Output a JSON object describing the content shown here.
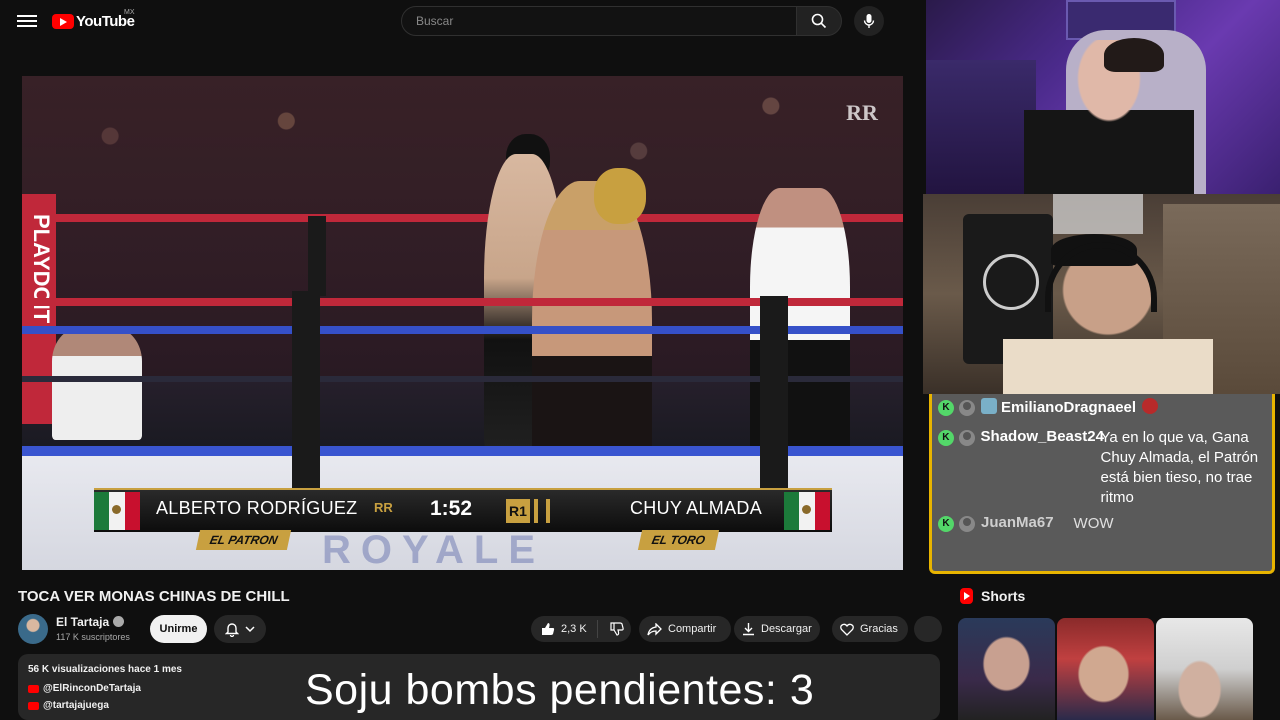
{
  "header": {
    "logo_text": "YouTube",
    "country": "MX",
    "search_placeholder": "Buscar"
  },
  "video": {
    "scoreboard": {
      "left_name": "ALBERTO RODRÍGUEZ",
      "left_nick": "EL PATRON",
      "right_name": "CHUY ALMADA",
      "right_nick": "EL TORO",
      "clock": "1:52",
      "round": "R1",
      "logo": "RR"
    },
    "sponsor_text": "PLAYDOIT",
    "brand_mark": "RR",
    "mat_text": "ROYALE"
  },
  "info": {
    "title": "TOCA VER MONAS CHINAS DE CHILL",
    "channel_name": "El Tartaja",
    "subscribers": "117 K suscriptores",
    "join_label": "Unirme",
    "likes": "2,3 K",
    "share_label": "Compartir",
    "download_label": "Descargar",
    "thanks_label": "Gracias"
  },
  "description": {
    "stats": "56 K visualizaciones  hace 1 mes",
    "links": [
      "@ElRinconDeTartaja",
      "@tartajajuega"
    ]
  },
  "overlay_text": "Soju bombs pendientes: 3",
  "chat": {
    "messages": [
      {
        "user": "EmilianoDragnaeel",
        "text": ""
      },
      {
        "user": "Shadow_Beast24",
        "text": "Ya en lo que va, Gana Chuy Almada, el Patrón está bien tieso, no trae ritmo"
      },
      {
        "user": "JuanMa67",
        "text": "WOW"
      }
    ],
    "badge_letter": "K",
    "accent_color": "#e8b400"
  },
  "shorts": {
    "label": "Shorts"
  },
  "colors": {
    "brand_red": "#ff0000",
    "scoreboard_gold": "#c8a040",
    "background": "#0f0f0f"
  }
}
